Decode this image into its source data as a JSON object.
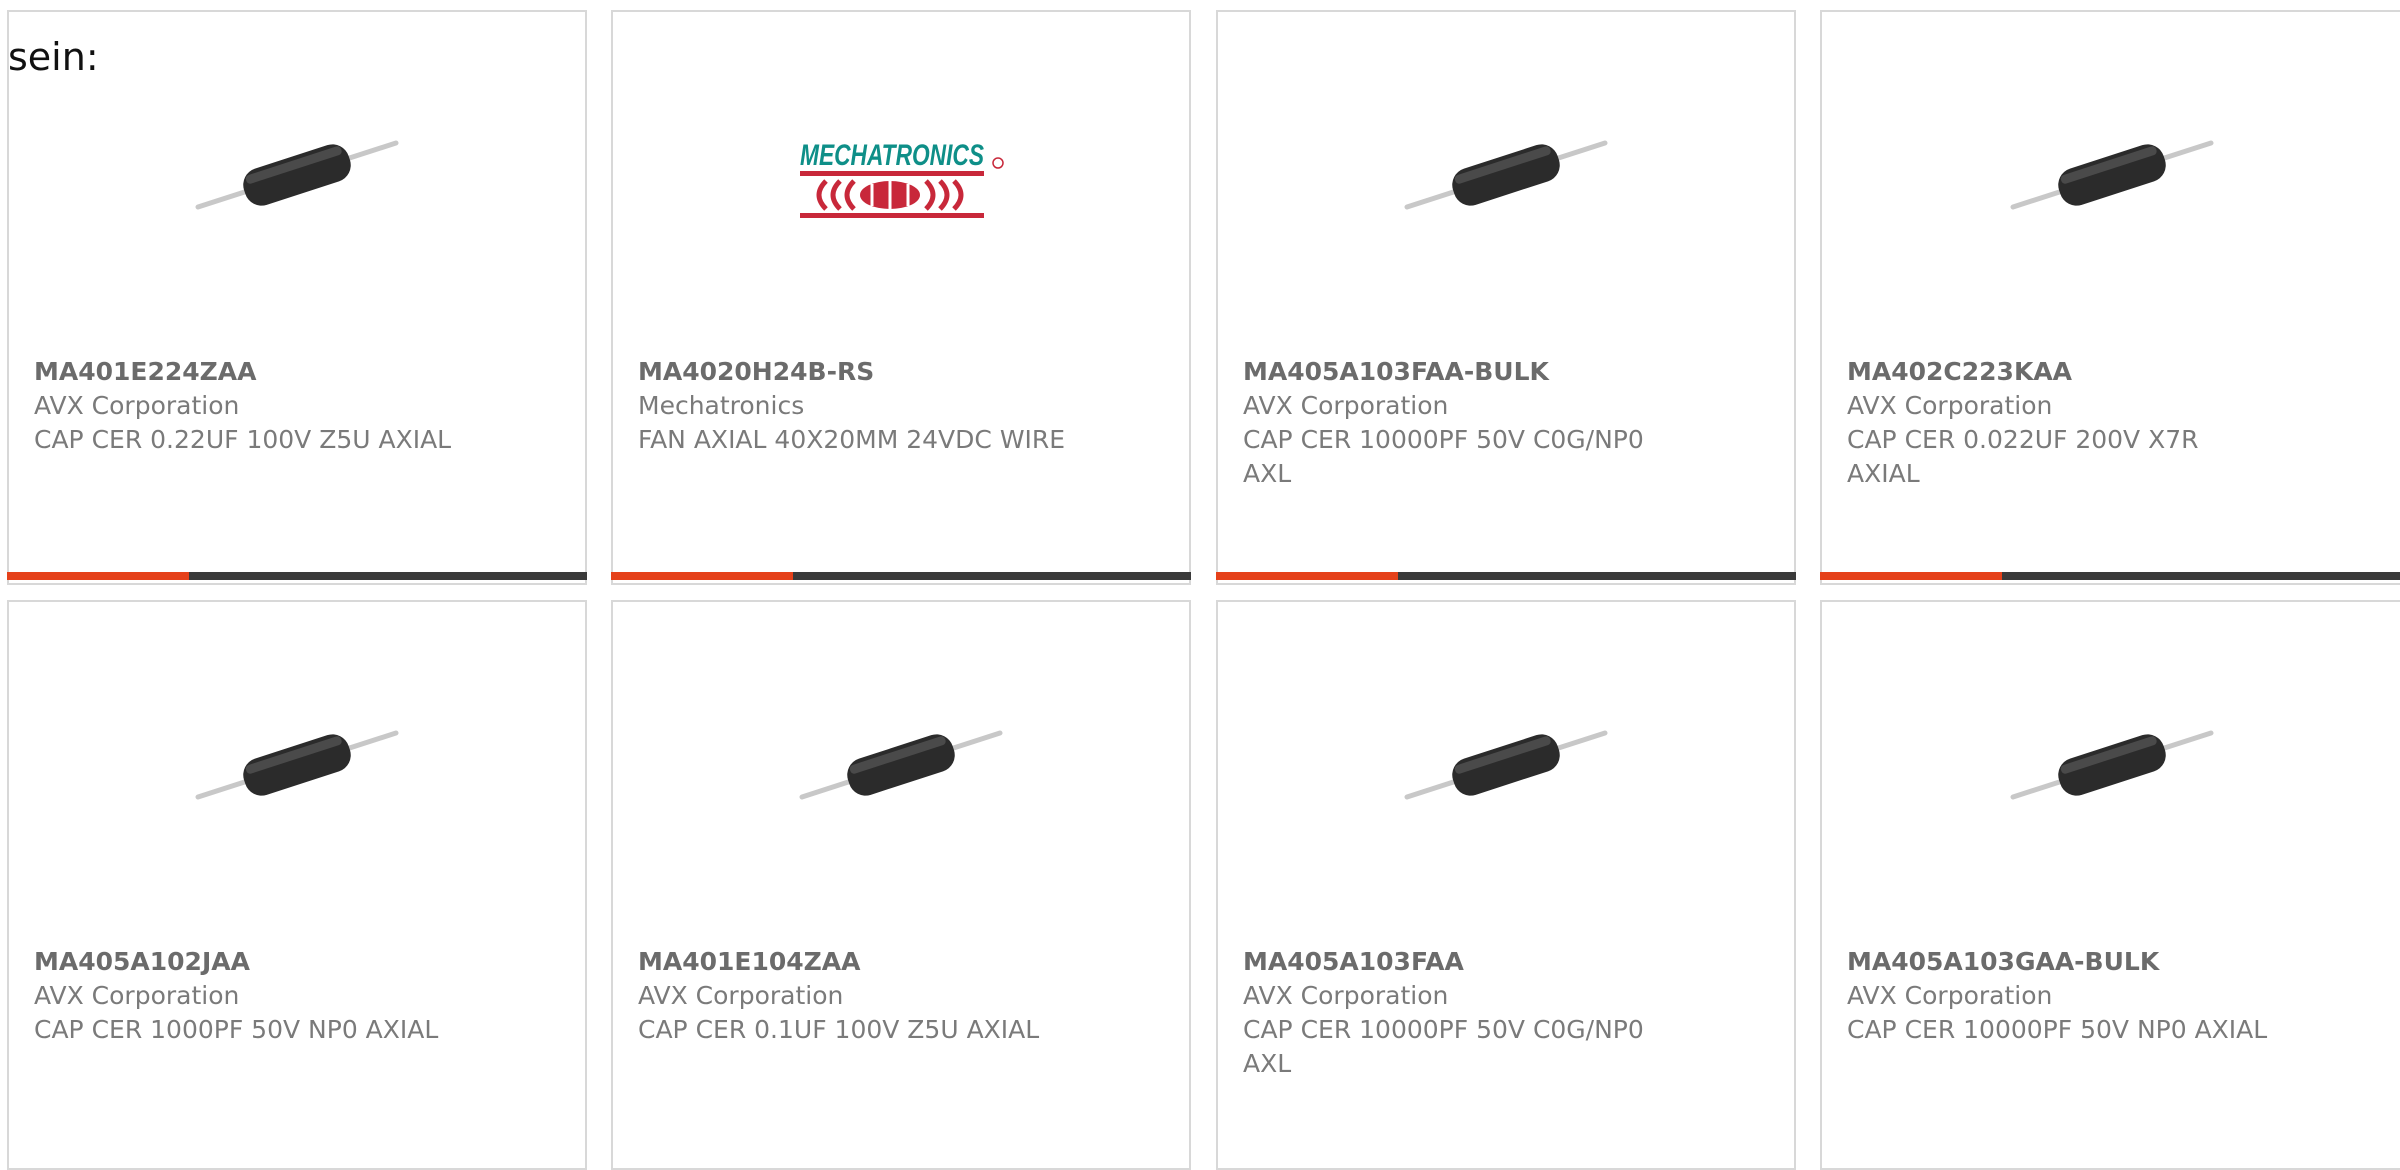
{
  "heading": "sein:",
  "colors": {
    "accent": "#e5411a",
    "bar": "#3a3a3a",
    "card_border": "#d8d8d8",
    "text_muted": "#7a7a7a"
  },
  "products": [
    {
      "part_number": "MA401E224ZAA",
      "manufacturer": "AVX Corporation",
      "description": "CAP CER 0.22UF 100V Z5U AXIAL",
      "image": "axial-capacitor"
    },
    {
      "part_number": "MA4020H24B-RS",
      "manufacturer": "Mechatronics",
      "description": "FAN AXIAL 40X20MM 24VDC WIRE",
      "image": "mechatronics-logo"
    },
    {
      "part_number": "MA405A103FAA-BULK",
      "manufacturer": "AVX Corporation",
      "description": "CAP CER 10000PF 50V C0G/NP0 AXL",
      "image": "axial-capacitor"
    },
    {
      "part_number": "MA402C223KAA",
      "manufacturer": "AVX Corporation",
      "description": "CAP CER 0.022UF 200V X7R AXIAL",
      "image": "axial-capacitor"
    },
    {
      "part_number": "MA405A102JAA",
      "manufacturer": "AVX Corporation",
      "description": "CAP CER 1000PF 50V NP0 AXIAL",
      "image": "axial-capacitor"
    },
    {
      "part_number": "MA401E104ZAA",
      "manufacturer": "AVX Corporation",
      "description": "CAP CER 0.1UF 100V Z5U AXIAL",
      "image": "axial-capacitor"
    },
    {
      "part_number": "MA405A103FAA",
      "manufacturer": "AVX Corporation",
      "description": "CAP CER 10000PF 50V C0G/NP0 AXL",
      "image": "axial-capacitor"
    },
    {
      "part_number": "MA405A103GAA-BULK",
      "manufacturer": "AVX Corporation",
      "description": "CAP CER 10000PF 50V NP0 AXIAL",
      "image": "axial-capacitor"
    }
  ],
  "logo_text": "MECHATRONICS"
}
